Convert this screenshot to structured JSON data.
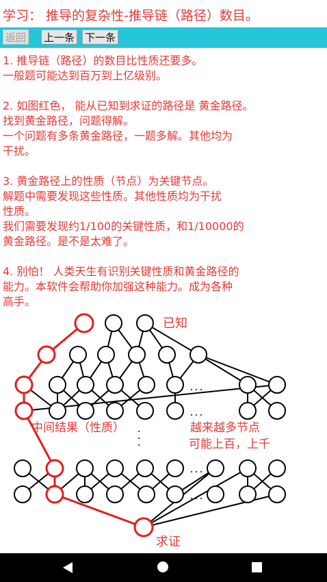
{
  "header": {
    "title": "学习： 推导的复杂性-推导链（路径）数目。"
  },
  "toolbar": {
    "back_label": "返回",
    "prev_label": "上一条",
    "next_label": "下一条"
  },
  "content": {
    "paragraphs": [
      {
        "lines": [
          "1. 推导链（路径）的数目比性质还要多。",
          "一般题可能达到百万到上亿级别。"
        ]
      },
      {
        "lines": [
          "2. 如图红色， 能从已知到求证的路径是 黄金路径。",
          "找到黄金路径，问题得解。",
          "一个问题有多条黄金路径，一题多解。其他均为",
          "干扰。"
        ]
      },
      {
        "lines": [
          "3. 黄金路径上的性质（节点）为关键节点。",
          "解题中需要发现这些性质。其他性质均为干扰",
          "性质。",
          "我们需要发现约1/100的关键性质，和1/10000的",
          "黄金路径。是不是太难了。"
        ]
      },
      {
        "lines": [
          "4. 别怕！ 人类天生有识别关键性质和黄金路径的",
          "能力。本软件会帮助你加强这种能力。成为各种",
          "高手。"
        ]
      }
    ]
  },
  "diagram": {
    "known_label": "已知",
    "middle_label": "中间结果（性质）",
    "more_nodes_label_1": "越来越多节点",
    "more_nodes_label_2": "可能上百，上千",
    "goal_label": "求证",
    "colors": {
      "golden_path": "#e01e1e",
      "edges": "#000000",
      "text": "#e53935"
    }
  },
  "navigation": {
    "back_icon": "back-triangle-icon",
    "home_icon": "home-circle-icon",
    "recent_icon": "recent-square-icon"
  }
}
